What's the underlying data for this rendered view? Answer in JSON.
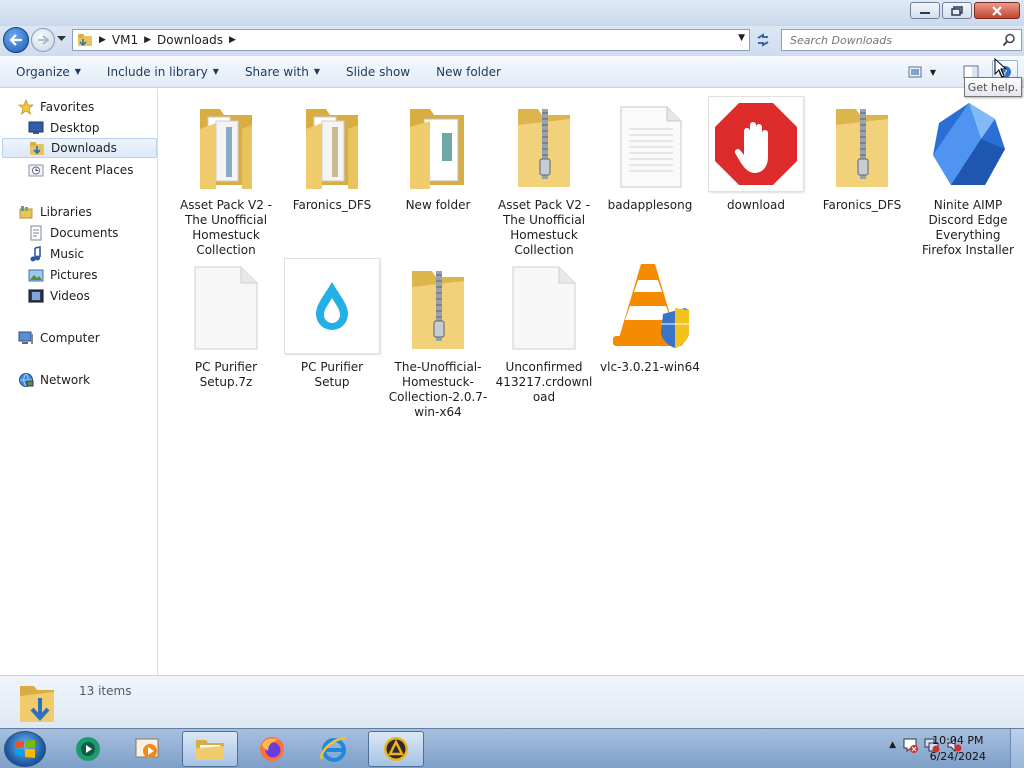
{
  "window": {
    "minimize_icon": "minimize-icon",
    "maximize_icon": "restore-icon",
    "close_icon": "close-icon"
  },
  "address": {
    "crumbs": [
      "VM1",
      "Downloads"
    ],
    "search_placeholder": "Search Downloads"
  },
  "toolbar": {
    "organize": "Organize",
    "include": "Include in library",
    "share": "Share with",
    "slideshow": "Slide show",
    "newfolder": "New folder",
    "tooltip": "Get help."
  },
  "nav": {
    "favorites": "Favorites",
    "desktop": "Desktop",
    "downloads": "Downloads",
    "recent": "Recent Places",
    "libraries": "Libraries",
    "documents": "Documents",
    "music": "Music",
    "pictures": "Pictures",
    "videos": "Videos",
    "computer": "Computer",
    "network": "Network"
  },
  "files": [
    {
      "name": "Asset Pack V2 - The Unofficial Homestuck Collection",
      "icon": "folder-docs-icon"
    },
    {
      "name": "Faronics_DFS",
      "icon": "folder-docs-icon"
    },
    {
      "name": "New folder",
      "icon": "folder-open-icon"
    },
    {
      "name": "Asset Pack V2 - The Unofficial Homestuck Collection",
      "icon": "zip-folder-icon"
    },
    {
      "name": "badapplesong",
      "icon": "text-file-icon"
    },
    {
      "name": "download",
      "icon": "adblock-icon"
    },
    {
      "name": "Faronics_DFS",
      "icon": "zip-folder-icon"
    },
    {
      "name": "Ninite AIMP Discord Edge Everything Firefox Installer",
      "icon": "ninite-icon"
    },
    {
      "name": "PC Purifier Setup.7z",
      "icon": "blank-file-icon"
    },
    {
      "name": "PC Purifier Setup",
      "icon": "drop-icon"
    },
    {
      "name": "The-Unofficial-Homestuck-Collection-2.0.7-win-x64",
      "icon": "zip-folder-icon"
    },
    {
      "name": "Unconfirmed 413217.crdownload",
      "icon": "blank-file-icon"
    },
    {
      "name": "vlc-3.0.21-win64",
      "icon": "vlc-icon"
    }
  ],
  "details": {
    "count": "13 items"
  },
  "clock": {
    "time": "10:04 PM",
    "date": "6/24/2024"
  },
  "colors": {
    "folder": "#f2d27a",
    "accent": "#1e395b",
    "selection": "#dce8f7"
  }
}
